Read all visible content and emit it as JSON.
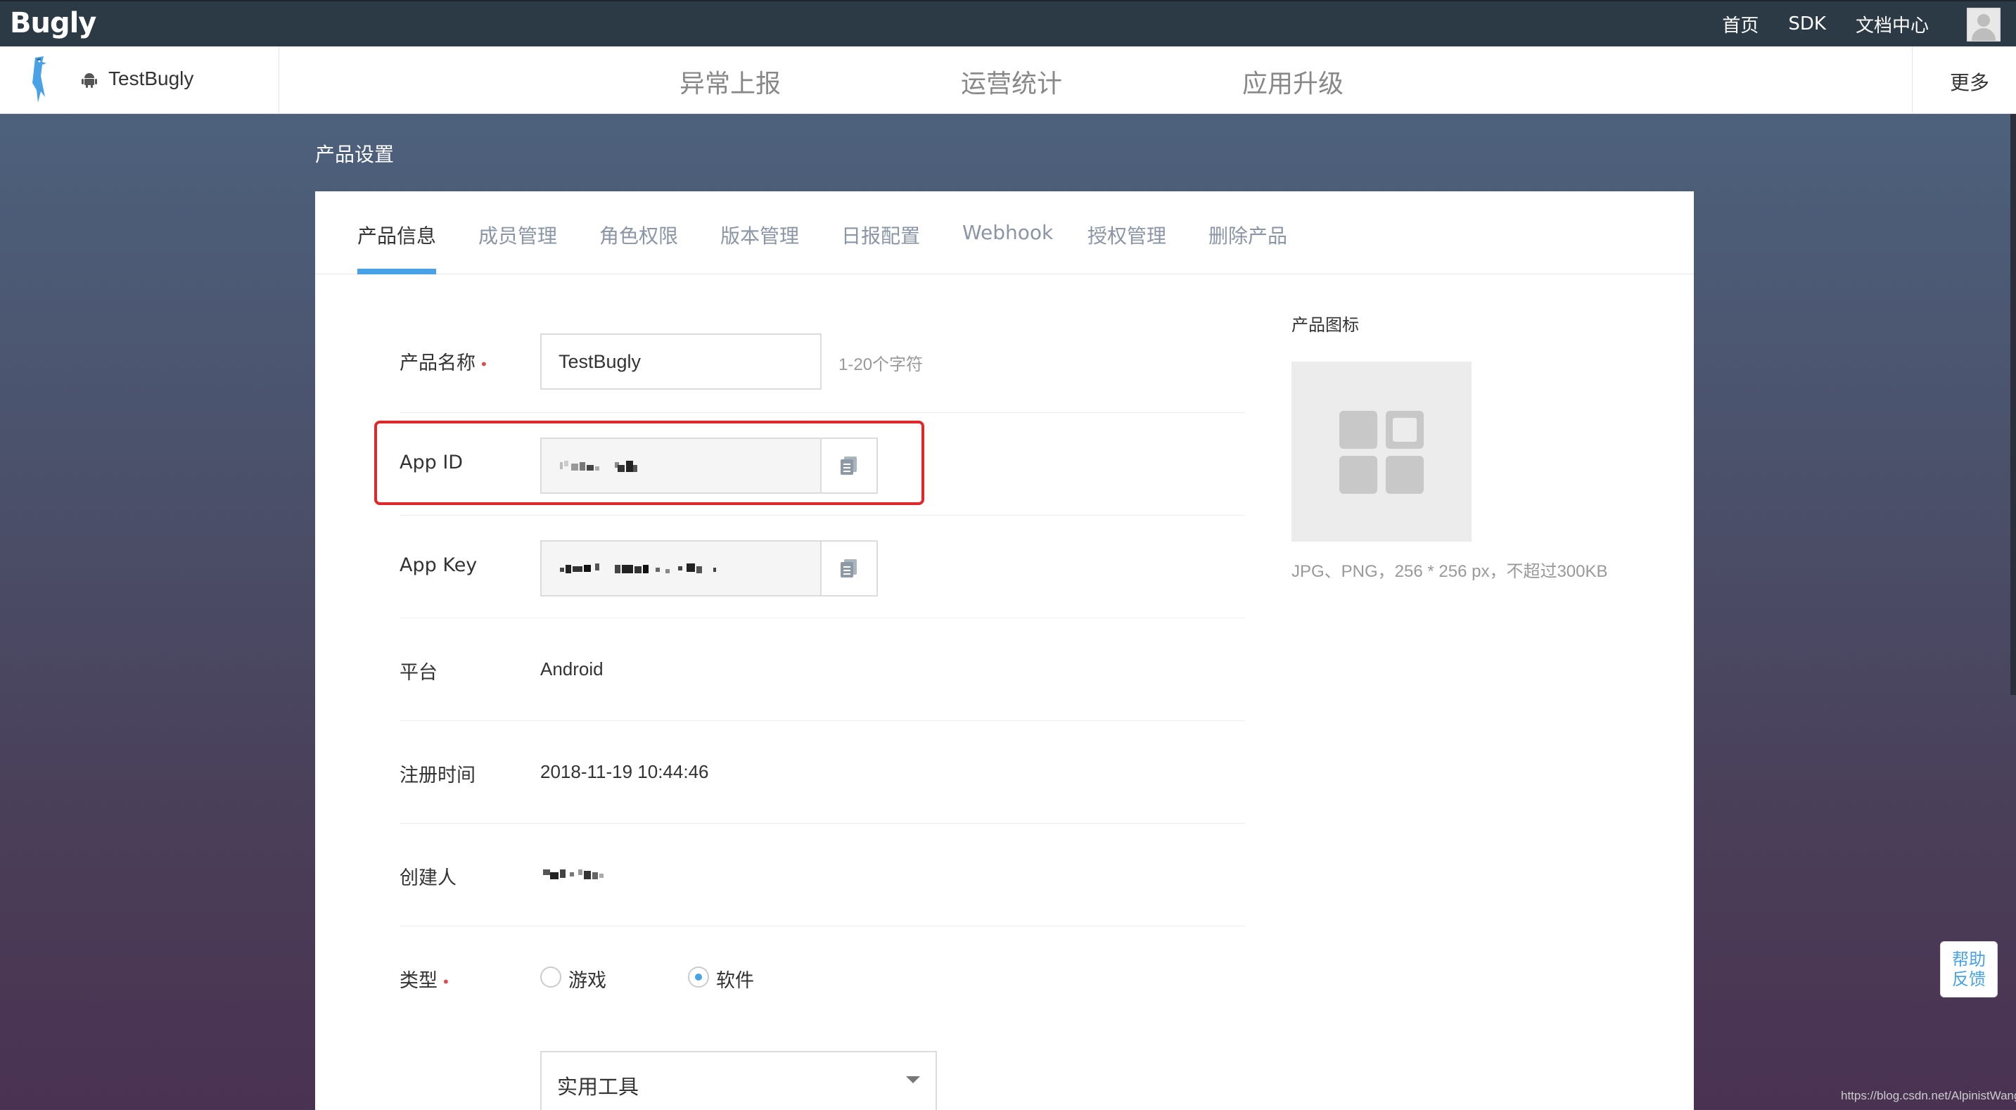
{
  "topbar": {
    "logo": "Bugly",
    "links": [
      "首页",
      "SDK",
      "文档中心"
    ]
  },
  "subnav": {
    "app_name": "TestBugly",
    "tabs": [
      "异常上报",
      "运营统计",
      "应用升级"
    ],
    "more": "更多"
  },
  "page_title": "产品设置",
  "settings_tabs": [
    "产品信息",
    "成员管理",
    "角色权限",
    "版本管理",
    "日报配置",
    "Webhook",
    "授权管理",
    "删除产品"
  ],
  "form": {
    "product_name_label": "产品名称",
    "product_name_value": "TestBugly",
    "product_name_hint": "1-20个字符",
    "app_id_label": "App ID",
    "app_key_label": "App Key",
    "platform_label": "平台",
    "platform_value": "Android",
    "register_time_label": "注册时间",
    "register_time_value": "2018-11-19 10:44:46",
    "creator_label": "创建人",
    "type_label": "类型",
    "type_options": [
      "游戏",
      "软件"
    ],
    "type_selected": "软件",
    "category_value": "实用工具"
  },
  "product_icon": {
    "label": "产品图标",
    "note": "JPG、PNG，256 * 256 px，不超过300KB"
  },
  "help_button": [
    "帮助",
    "反馈"
  ],
  "watermark": "https://blog.csdn.net/AlpinistWang",
  "colors": {
    "accent": "#4aa2e6",
    "highlight": "#e0272a",
    "topbar": "#2c3a45"
  }
}
